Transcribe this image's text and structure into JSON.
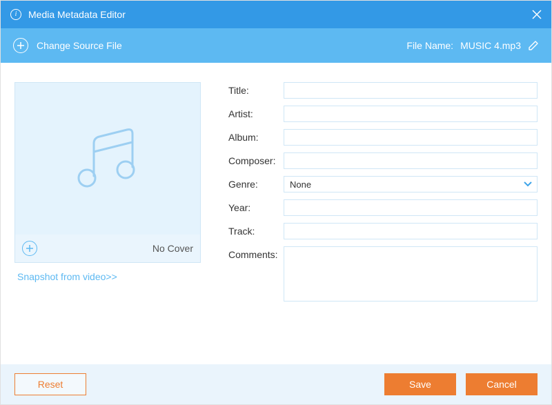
{
  "titlebar": {
    "title": "Media Metadata Editor"
  },
  "toolbar": {
    "change_source_label": "Change Source File",
    "file_name_label": "File Name:",
    "file_name_value": "MUSIC 4.mp3"
  },
  "cover": {
    "no_cover_label": "No Cover",
    "snapshot_link": "Snapshot from video>>"
  },
  "form": {
    "title_label": "Title:",
    "artist_label": "Artist:",
    "album_label": "Album:",
    "composer_label": "Composer:",
    "genre_label": "Genre:",
    "year_label": "Year:",
    "track_label": "Track:",
    "comments_label": "Comments:",
    "title_value": "",
    "artist_value": "",
    "album_value": "",
    "composer_value": "",
    "genre_value": "None",
    "year_value": "",
    "track_value": "",
    "comments_value": ""
  },
  "footer": {
    "reset_label": "Reset",
    "save_label": "Save",
    "cancel_label": "Cancel"
  }
}
